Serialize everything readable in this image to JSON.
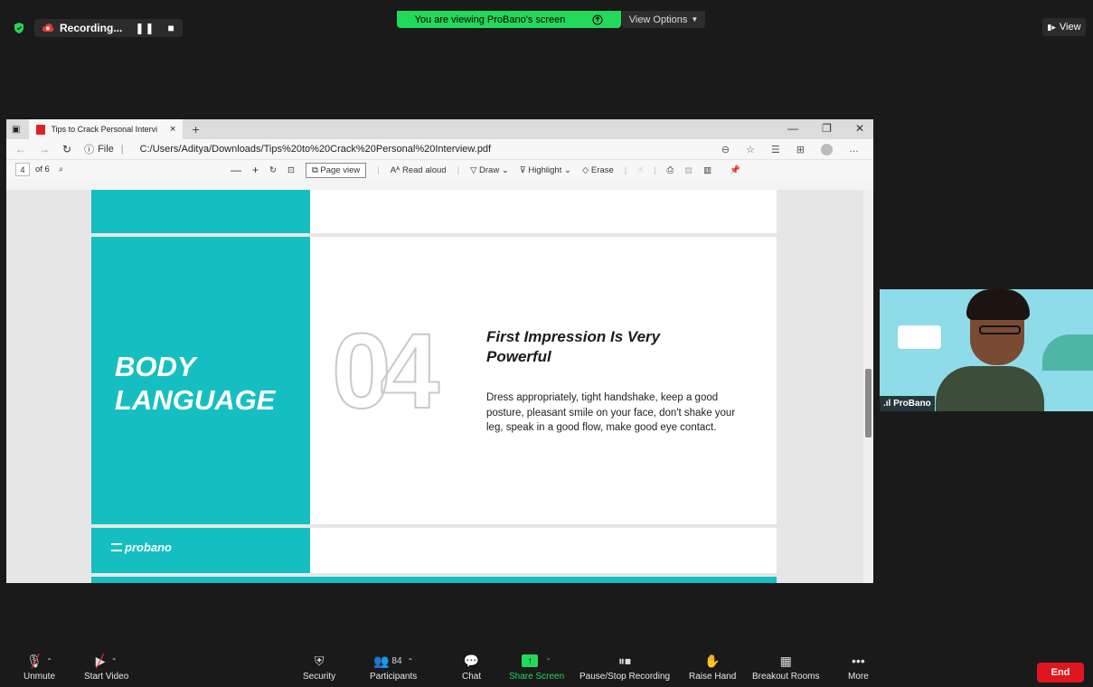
{
  "topbar": {
    "recording_label": "Recording...",
    "banner_text": "You are viewing ProBano's screen",
    "view_options_label": "View Options",
    "view_label": "View"
  },
  "browser": {
    "tab_title": "Tips to Crack Personal Interview",
    "file_label": "File",
    "url": "C:/Users/Aditya/Downloads/Tips%20to%20Crack%20Personal%20Interview.pdf",
    "page_current": "4",
    "page_total": "of 6",
    "tools": {
      "page_view": "Page view",
      "read_aloud": "Read aloud",
      "draw": "Draw",
      "highlight": "Highlight",
      "erase": "Erase"
    }
  },
  "pdf": {
    "section_title_line1": "BODY",
    "section_title_line2": "LANGUAGE",
    "number": "04",
    "content_title": "First Impression Is Very Powerful",
    "content_body": "Dress appropriately, tight handshake, keep a good posture, pleasant smile on your face, don't shake your leg, speak in a good flow, make good eye contact.",
    "logo_text": "probano"
  },
  "participant": {
    "name": "ProBano"
  },
  "toolbar": {
    "unmute": "Unmute",
    "start_video": "Start Video",
    "security": "Security",
    "participants": "Participants",
    "participant_count": "84",
    "chat": "Chat",
    "share_screen": "Share Screen",
    "pause_stop_recording": "Pause/Stop Recording",
    "raise_hand": "Raise Hand",
    "breakout_rooms": "Breakout Rooms",
    "more": "More",
    "end": "End"
  },
  "colors": {
    "teal": "#15bfc1",
    "zoom_green": "#23d959",
    "end_red": "#e0161e"
  }
}
